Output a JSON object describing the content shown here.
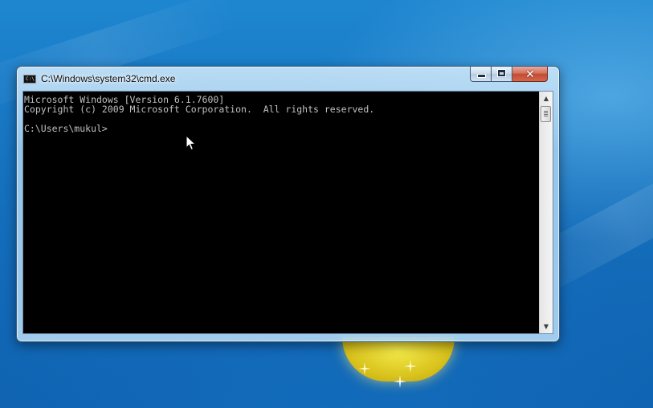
{
  "window": {
    "title": "C:\\Windows\\system32\\cmd.exe",
    "icon_label": "C:\\",
    "icon": "console-icon",
    "buttons": {
      "minimize": "minimize-icon",
      "maximize": "maximize-icon",
      "close_label": "✕"
    }
  },
  "console": {
    "lines": [
      "Microsoft Windows [Version 6.1.7600]",
      "Copyright (c) 2009 Microsoft Corporation.  All rights reserved.",
      "",
      "C:\\Users\\mukul>"
    ],
    "text_color": "#c0c0c0",
    "background": "#000000"
  },
  "scrollbar": {
    "up_arrow": "▲",
    "down_arrow": "▼"
  }
}
